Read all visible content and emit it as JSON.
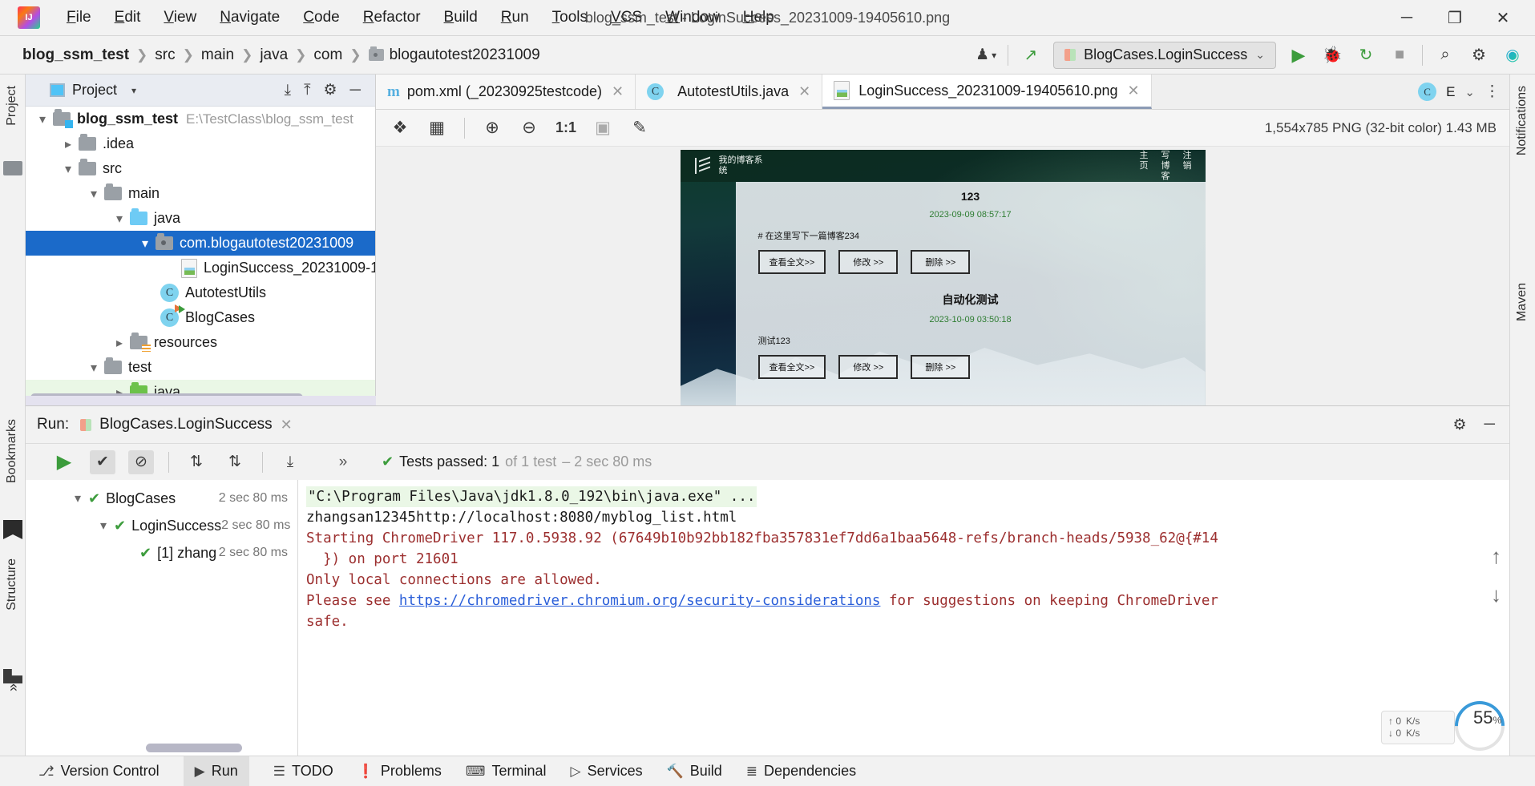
{
  "titlebar": {
    "menu": [
      "File",
      "Edit",
      "View",
      "Navigate",
      "Code",
      "Refactor",
      "Build",
      "Run",
      "Tools",
      "VCS",
      "Window",
      "Help"
    ],
    "window_title": "blog_ssm_test - LoginSuccess_20231009-19405610.png",
    "minimize": "─",
    "maximize": "❐",
    "close": "✕"
  },
  "navbar": {
    "crumbs": [
      "blog_ssm_test",
      "src",
      "main",
      "java",
      "com",
      "blogautotest20231009"
    ],
    "separator": "❯",
    "run_config": "BlogCases.LoginSuccess",
    "run_config_caret": "⌄",
    "icons": {
      "user": "♟",
      "user_caret": "▾",
      "updates": "↖",
      "run": "▶",
      "debug": "🐞",
      "run_coverage": "↻",
      "stop": "■",
      "search": "⌕",
      "settings": "⚙"
    }
  },
  "left_strip": {
    "project_label": "Project",
    "bookmarks_label": "Bookmarks",
    "structure_label": "Structure",
    "more_label": "»"
  },
  "right_strip": {
    "notifications_label": "Notifications",
    "maven_label": "Maven"
  },
  "project_panel": {
    "title": "Project",
    "caret": "▾",
    "icons": {
      "collapse_all": "⤓",
      "expand": "⤒",
      "settings": "⚙",
      "hide": "─"
    },
    "tree": [
      {
        "label": "blog_ssm_test",
        "path": "E:\\TestClass\\blog_ssm_test",
        "indent": 0,
        "arrow": "down",
        "icon": "folder-module",
        "bold": true
      },
      {
        "label": ".idea",
        "indent": 1,
        "arrow": "right",
        "icon": "folder"
      },
      {
        "label": "src",
        "indent": 1,
        "arrow": "down",
        "icon": "folder"
      },
      {
        "label": "main",
        "indent": 2,
        "arrow": "down",
        "icon": "folder"
      },
      {
        "label": "java",
        "indent": 3,
        "arrow": "down",
        "icon": "folder-source"
      },
      {
        "label": "com.blogautotest20231009",
        "indent": 4,
        "arrow": "down",
        "icon": "folder-package",
        "selected": true
      },
      {
        "label": "LoginSuccess_20231009-1",
        "indent": 5,
        "arrow": "none",
        "icon": "image"
      },
      {
        "label": "AutotestUtils",
        "indent": 5,
        "arrow": "none",
        "icon": "class"
      },
      {
        "label": "BlogCases",
        "indent": 5,
        "arrow": "none",
        "icon": "class-run"
      },
      {
        "label": "resources",
        "indent": 3,
        "arrow": "right",
        "icon": "folder-resource"
      },
      {
        "label": "test",
        "indent": 2,
        "arrow": "down",
        "icon": "folder"
      },
      {
        "label": "java",
        "indent": 3,
        "arrow": "right",
        "icon": "folder-test",
        "highlight": true
      }
    ]
  },
  "editor": {
    "tabs": [
      {
        "label": "pom.xml (_20230925testcode)",
        "icon": "maven-icon",
        "close": "✕",
        "active": false
      },
      {
        "label": "AutotestUtils.java",
        "icon": "class-icon",
        "close": "✕",
        "active": false
      },
      {
        "label": "LoginSuccess_20231009-19405610.png",
        "icon": "image-icon",
        "close": "✕",
        "active": true
      }
    ],
    "tabbar_right": {
      "class_badge": "C",
      "label": "E",
      "caret": "⌄",
      "more": "⋮"
    },
    "image_toolbar": {
      "buttons": [
        "fit-icon",
        "grid-icon",
        "zoom-in-icon",
        "zoom-out-icon",
        "actual-size-icon",
        "transparency-icon",
        "color-picker-icon"
      ],
      "glyphs": {
        "fit": "❖",
        "grid": "▦",
        "zoom_in": "⊕",
        "zoom_out": "⊖",
        "actual_size": "1:1",
        "transparency": "▣",
        "picker": "✎"
      },
      "info": "1,554x785 PNG (32-bit color) 1.43 MB"
    },
    "screenshot": {
      "brand": "我的博客系统",
      "nav_links": [
        "主页",
        "写博客",
        "注销"
      ],
      "posts": [
        {
          "title": "123",
          "date": "2023-09-09 08:57:17",
          "body": "# 在这里写下一篇博客234",
          "buttons": [
            "查看全文>>",
            "修改 >>",
            "删除 >>"
          ]
        },
        {
          "title": "自动化测试",
          "date": "2023-10-09 03:50:18",
          "body": "测试123",
          "buttons": [
            "查看全文>>",
            "修改 >>",
            "删除 >>"
          ]
        }
      ]
    }
  },
  "run_panel": {
    "label": "Run:",
    "tab": "BlogCases.LoginSuccess",
    "tab_close": "✕",
    "header_icons": {
      "settings": "⚙",
      "hide": "─"
    },
    "toolbar": {
      "buttons": [
        "rerun-icon",
        "show-passed-icon",
        "hide-passed-icon",
        "sort-alpha-icon",
        "sort-duration-icon",
        "expand-all-icon",
        "more-icon"
      ],
      "glyphs": {
        "rerun": "▶",
        "passed": "✔",
        "ignored": "⊘",
        "sort_alpha": "⇅",
        "sort_dur": "⇅",
        "expand": "⤓",
        "more": "»"
      }
    },
    "status": {
      "check": "✔",
      "text": "Tests passed: 1",
      "grey": "of 1 test",
      "time": "– 2 sec 80 ms"
    },
    "tests": [
      {
        "label": "BlogCases",
        "duration": "2 sec 80 ms",
        "indent": 0,
        "arrow": "down",
        "check": "✔"
      },
      {
        "label": "LoginSuccess",
        "duration": "2 sec 80 ms",
        "indent": 1,
        "arrow": "down",
        "check": "✔"
      },
      {
        "label": "[1] zhang",
        "duration": "2 sec 80 ms",
        "indent": 2,
        "arrow": "none",
        "check": "✔"
      }
    ],
    "console": [
      {
        "text": "\"C:\\Program Files\\Java\\jdk1.8.0_192\\bin\\java.exe\" ...",
        "style": "green-bg"
      },
      {
        "text": "zhangsan12345http://localhost:8080/myblog_list.html",
        "style": "dark"
      },
      {
        "text": "Starting ChromeDriver 117.0.5938.92 (67649b10b92bb182fba357831ef7dd6a1baa5648-refs/branch-heads/5938_62@{#14",
        "style": "red"
      },
      {
        "text": "  }) on port 21601",
        "style": "red"
      },
      {
        "text": "Only local connections are allowed.",
        "style": "red"
      },
      {
        "text": "Please see ",
        "style": "red",
        "link": "https://chromedriver.chromium.org/security-considerations",
        "after": " for suggestions on keeping ChromeDriver"
      },
      {
        "text": "safe.",
        "style": "red"
      }
    ],
    "scroll_up": "↑",
    "scroll_down": "↓"
  },
  "widgets": {
    "speed_up": "↑ 0",
    "speed_up_unit": "K/s",
    "speed_down": "↓ 0",
    "speed_down_unit": "K/s",
    "gauge_value": "55",
    "gauge_unit": "%"
  },
  "statusbar": {
    "items": [
      {
        "label": "Version Control",
        "icon": "⎇",
        "active": false
      },
      {
        "label": "Run",
        "icon": "▶",
        "active": true
      },
      {
        "label": "TODO",
        "icon": "☰",
        "active": false
      },
      {
        "label": "Problems",
        "icon": "❗",
        "active": false
      },
      {
        "label": "Terminal",
        "icon": "⌨",
        "active": false
      },
      {
        "label": "Services",
        "icon": "▷",
        "active": false
      },
      {
        "label": "Build",
        "icon": "🔨",
        "active": false
      },
      {
        "label": "Dependencies",
        "icon": "≣",
        "active": false
      }
    ]
  },
  "colors": {
    "accent_blue": "#1b6ac9",
    "green": "#3c9c3c",
    "console_red": "#9c2f2f",
    "link_blue": "#2b5fd9"
  }
}
